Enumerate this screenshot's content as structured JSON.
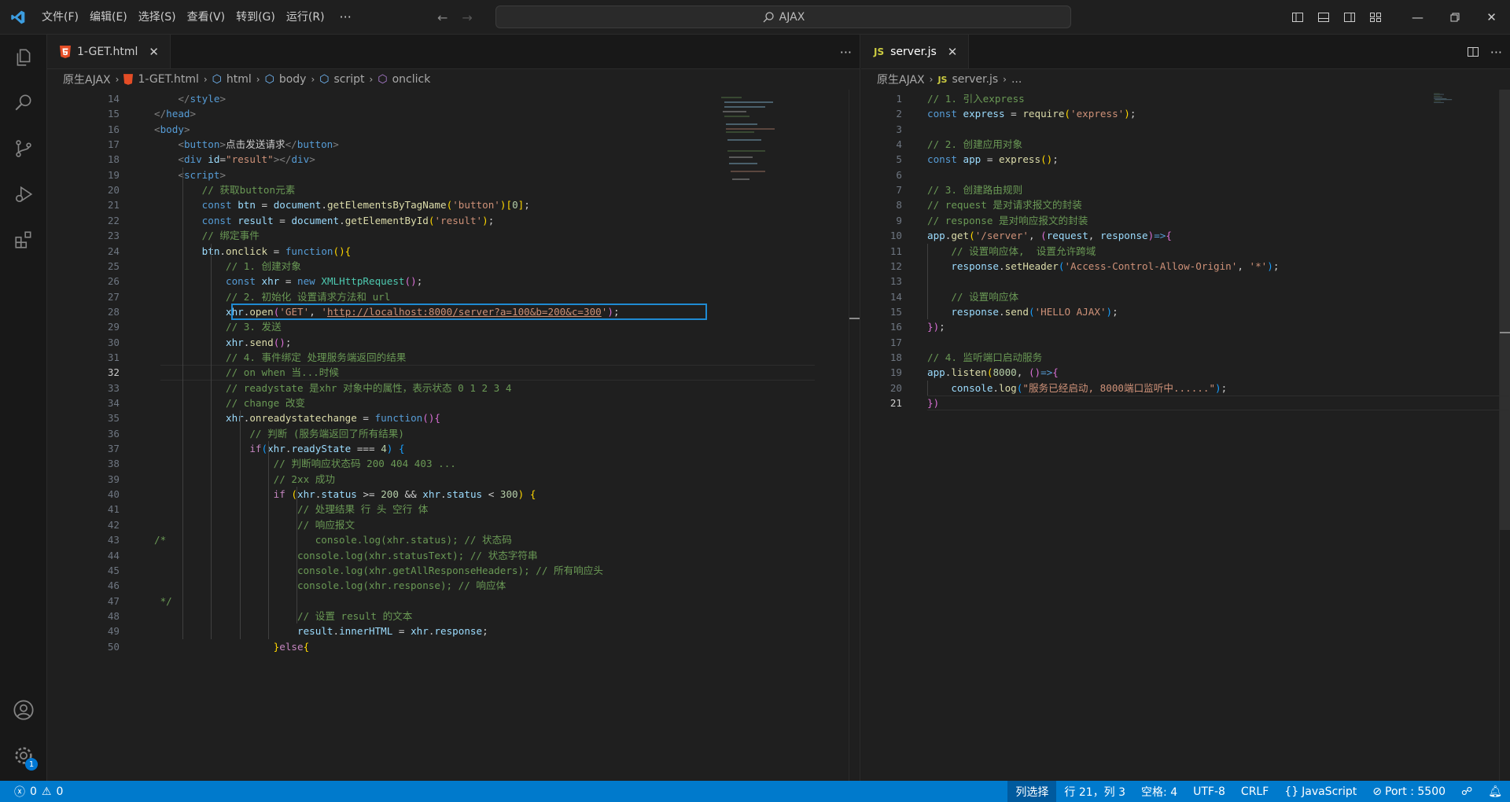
{
  "menu": [
    "文件(F)",
    "编辑(E)",
    "选择(S)",
    "查看(V)",
    "转到(G)",
    "运行(R)"
  ],
  "search": {
    "label": "AJAX"
  },
  "left": {
    "tab": "1-GET.html",
    "breadcrumb": [
      "原生AJAX",
      "1-GET.html",
      "html",
      "body",
      "script",
      "onclick"
    ],
    "current_line": "32"
  },
  "right": {
    "tab": "server.js",
    "breadcrumb": [
      "原生AJAX",
      "server.js",
      "..."
    ],
    "current_line": "21"
  },
  "status": {
    "errors": "0",
    "warnings": "0",
    "selection_mode": "列选择",
    "position": "行 21，列 3",
    "spaces": "空格: 4",
    "encoding": "UTF-8",
    "eol": "CRLF",
    "language": "JavaScript",
    "port": "Port : 5500"
  },
  "activity_badge": "1",
  "colors": {
    "accent": "#007acc",
    "highlight_box": "#1f8ad2"
  },
  "left_code": [
    {
      "n": "14",
      "t": [
        [
          "    ",
          "c-plain"
        ],
        [
          "</",
          "c-tagb"
        ],
        [
          "style",
          "c-tag"
        ],
        [
          ">",
          "c-tagb"
        ]
      ]
    },
    {
      "n": "15",
      "t": [
        [
          "</",
          "c-tagb"
        ],
        [
          "head",
          "c-tag"
        ],
        [
          ">",
          "c-tagb"
        ]
      ]
    },
    {
      "n": "16",
      "t": [
        [
          "<",
          "c-tagb"
        ],
        [
          "body",
          "c-tag"
        ],
        [
          ">",
          "c-tagb"
        ]
      ]
    },
    {
      "n": "17",
      "t": [
        [
          "    ",
          "c-plain"
        ],
        [
          "<",
          "c-tagb"
        ],
        [
          "button",
          "c-tag"
        ],
        [
          ">",
          "c-tagb"
        ],
        [
          "点击发送请求",
          "c-plain"
        ],
        [
          "</",
          "c-tagb"
        ],
        [
          "button",
          "c-tag"
        ],
        [
          ">",
          "c-tagb"
        ]
      ]
    },
    {
      "n": "18",
      "t": [
        [
          "    ",
          "c-plain"
        ],
        [
          "<",
          "c-tagb"
        ],
        [
          "div",
          "c-tag"
        ],
        [
          " ",
          "c-plain"
        ],
        [
          "id",
          "c-attr"
        ],
        [
          "=",
          "c-plain"
        ],
        [
          "\"result\"",
          "c-str"
        ],
        [
          "></",
          "c-tagb"
        ],
        [
          "div",
          "c-tag"
        ],
        [
          ">",
          "c-tagb"
        ]
      ]
    },
    {
      "n": "19",
      "t": [
        [
          "    ",
          "c-plain"
        ],
        [
          "<",
          "c-tagb"
        ],
        [
          "script",
          "c-tag"
        ],
        [
          ">",
          "c-tagb"
        ]
      ]
    },
    {
      "n": "20",
      "t": [
        [
          "        ",
          "c-plain"
        ],
        [
          "// 获取button元素",
          "c-com"
        ]
      ]
    },
    {
      "n": "21",
      "t": [
        [
          "        ",
          "c-plain"
        ],
        [
          "const",
          "c-kw"
        ],
        [
          " ",
          "c-plain"
        ],
        [
          "btn",
          "c-var"
        ],
        [
          " = ",
          "c-plain"
        ],
        [
          "document",
          "c-var"
        ],
        [
          ".",
          "c-plain"
        ],
        [
          "getElementsByTagName",
          "c-fn"
        ],
        [
          "(",
          "c-b1"
        ],
        [
          "'button'",
          "c-str"
        ],
        [
          ")",
          "c-b1"
        ],
        [
          "[",
          "c-b1"
        ],
        [
          "0",
          "c-num"
        ],
        [
          "]",
          "c-b1"
        ],
        [
          ";",
          "c-plain"
        ]
      ]
    },
    {
      "n": "22",
      "t": [
        [
          "        ",
          "c-plain"
        ],
        [
          "const",
          "c-kw"
        ],
        [
          " ",
          "c-plain"
        ],
        [
          "result",
          "c-var"
        ],
        [
          " = ",
          "c-plain"
        ],
        [
          "document",
          "c-var"
        ],
        [
          ".",
          "c-plain"
        ],
        [
          "getElementById",
          "c-fn"
        ],
        [
          "(",
          "c-b1"
        ],
        [
          "'result'",
          "c-str"
        ],
        [
          ")",
          "c-b1"
        ],
        [
          ";",
          "c-plain"
        ]
      ]
    },
    {
      "n": "23",
      "t": [
        [
          "        ",
          "c-plain"
        ],
        [
          "// 绑定事件",
          "c-com"
        ]
      ]
    },
    {
      "n": "24",
      "t": [
        [
          "        ",
          "c-plain"
        ],
        [
          "btn",
          "c-var"
        ],
        [
          ".",
          "c-plain"
        ],
        [
          "onclick",
          "c-fn"
        ],
        [
          " = ",
          "c-plain"
        ],
        [
          "function",
          "c-kw"
        ],
        [
          "(){",
          "c-b1"
        ]
      ]
    },
    {
      "n": "25",
      "t": [
        [
          "            ",
          "c-plain"
        ],
        [
          "// 1. 创建对象",
          "c-com"
        ]
      ]
    },
    {
      "n": "26",
      "t": [
        [
          "            ",
          "c-plain"
        ],
        [
          "const",
          "c-kw"
        ],
        [
          " ",
          "c-plain"
        ],
        [
          "xhr",
          "c-var"
        ],
        [
          " = ",
          "c-plain"
        ],
        [
          "new",
          "c-kw"
        ],
        [
          " ",
          "c-plain"
        ],
        [
          "XMLHttpRequest",
          "c-cls"
        ],
        [
          "()",
          "c-b2"
        ],
        [
          ";",
          "c-plain"
        ]
      ]
    },
    {
      "n": "27",
      "t": [
        [
          "            ",
          "c-plain"
        ],
        [
          "// 2. 初始化 设置请求方法和 url",
          "c-com"
        ]
      ]
    },
    {
      "n": "28",
      "t": [
        [
          "            ",
          "c-plain"
        ],
        [
          "xhr",
          "c-var"
        ],
        [
          ".",
          "c-plain"
        ],
        [
          "open",
          "c-fn"
        ],
        [
          "(",
          "c-b2"
        ],
        [
          "'GET'",
          "c-str"
        ],
        [
          ", ",
          "c-plain"
        ],
        [
          "'",
          "c-str"
        ],
        [
          "http://localhost:8000/server?a=100&b=200&c=300",
          "c-str c-under"
        ],
        [
          "'",
          "c-str"
        ],
        [
          ")",
          "c-b2"
        ],
        [
          ";",
          "c-plain"
        ]
      ]
    },
    {
      "n": "29",
      "t": [
        [
          "            ",
          "c-plain"
        ],
        [
          "// 3. 发送",
          "c-com"
        ]
      ]
    },
    {
      "n": "30",
      "t": [
        [
          "            ",
          "c-plain"
        ],
        [
          "xhr",
          "c-var"
        ],
        [
          ".",
          "c-plain"
        ],
        [
          "send",
          "c-fn"
        ],
        [
          "()",
          "c-b2"
        ],
        [
          ";",
          "c-plain"
        ]
      ]
    },
    {
      "n": "31",
      "t": [
        [
          "            ",
          "c-plain"
        ],
        [
          "// 4. 事件绑定 处理服务端返回的结果",
          "c-com"
        ]
      ]
    },
    {
      "n": "32",
      "t": [
        [
          "            ",
          "c-plain"
        ],
        [
          "// on when 当...时候",
          "c-com"
        ]
      ]
    },
    {
      "n": "33",
      "t": [
        [
          "            ",
          "c-plain"
        ],
        [
          "// readystate 是xhr 对象中的属性，表示状态 0 1 2 3 4",
          "c-com"
        ]
      ]
    },
    {
      "n": "34",
      "t": [
        [
          "            ",
          "c-plain"
        ],
        [
          "// change 改变",
          "c-com"
        ]
      ]
    },
    {
      "n": "35",
      "t": [
        [
          "            ",
          "c-plain"
        ],
        [
          "xhr",
          "c-var"
        ],
        [
          ".",
          "c-plain"
        ],
        [
          "onreadystatechange",
          "c-fn"
        ],
        [
          " = ",
          "c-plain"
        ],
        [
          "function",
          "c-kw"
        ],
        [
          "(){",
          "c-b2"
        ]
      ]
    },
    {
      "n": "36",
      "t": [
        [
          "                ",
          "c-plain"
        ],
        [
          "// 判断 (服务端返回了所有结果)",
          "c-com"
        ]
      ]
    },
    {
      "n": "37",
      "t": [
        [
          "                ",
          "c-plain"
        ],
        [
          "if",
          "c-ctrl"
        ],
        [
          "(",
          "c-b3"
        ],
        [
          "xhr",
          "c-var"
        ],
        [
          ".",
          "c-plain"
        ],
        [
          "readyState",
          "c-var"
        ],
        [
          " === ",
          "c-plain"
        ],
        [
          "4",
          "c-num"
        ],
        [
          ")",
          "c-b3"
        ],
        [
          " ",
          "c-plain"
        ],
        [
          "{",
          "c-b3"
        ]
      ]
    },
    {
      "n": "38",
      "t": [
        [
          "                    ",
          "c-plain"
        ],
        [
          "// 判断响应状态码 200 404 403 ...",
          "c-com"
        ]
      ]
    },
    {
      "n": "39",
      "t": [
        [
          "                    ",
          "c-plain"
        ],
        [
          "// 2xx 成功",
          "c-com"
        ]
      ]
    },
    {
      "n": "40",
      "t": [
        [
          "                    ",
          "c-plain"
        ],
        [
          "if",
          "c-ctrl"
        ],
        [
          " ",
          "c-plain"
        ],
        [
          "(",
          "c-b1"
        ],
        [
          "xhr",
          "c-var"
        ],
        [
          ".",
          "c-plain"
        ],
        [
          "status",
          "c-var"
        ],
        [
          " >= ",
          "c-plain"
        ],
        [
          "200",
          "c-num"
        ],
        [
          " && ",
          "c-plain"
        ],
        [
          "xhr",
          "c-var"
        ],
        [
          ".",
          "c-plain"
        ],
        [
          "status",
          "c-var"
        ],
        [
          " < ",
          "c-plain"
        ],
        [
          "300",
          "c-num"
        ],
        [
          ")",
          "c-b1"
        ],
        [
          " ",
          "c-plain"
        ],
        [
          "{",
          "c-b1"
        ]
      ]
    },
    {
      "n": "41",
      "t": [
        [
          "                        ",
          "c-plain"
        ],
        [
          "// 处理结果 行 头 空行 体",
          "c-com"
        ]
      ]
    },
    {
      "n": "42",
      "t": [
        [
          "                        ",
          "c-plain"
        ],
        [
          "// 响应报文",
          "c-com"
        ]
      ]
    },
    {
      "n": "43",
      "t": [
        [
          "/*                         console.log(xhr.status); // 状态码",
          "c-com"
        ]
      ]
    },
    {
      "n": "44",
      "t": [
        [
          "                        console.log(xhr.statusText); // 状态字符串",
          "c-com"
        ]
      ]
    },
    {
      "n": "45",
      "t": [
        [
          "                        console.log(xhr.getAllResponseHeaders); // 所有响应头",
          "c-com"
        ]
      ]
    },
    {
      "n": "46",
      "t": [
        [
          "                        console.log(xhr.response); // 响应体",
          "c-com"
        ]
      ]
    },
    {
      "n": "47",
      "t": [
        [
          " */",
          "c-com"
        ]
      ]
    },
    {
      "n": "48",
      "t": [
        [
          "                        ",
          "c-plain"
        ],
        [
          "// 设置 result 的文本",
          "c-com"
        ]
      ]
    },
    {
      "n": "49",
      "t": [
        [
          "                        ",
          "c-plain"
        ],
        [
          "result",
          "c-var"
        ],
        [
          ".",
          "c-plain"
        ],
        [
          "innerHTML",
          "c-var"
        ],
        [
          " = ",
          "c-plain"
        ],
        [
          "xhr",
          "c-var"
        ],
        [
          ".",
          "c-plain"
        ],
        [
          "response",
          "c-var"
        ],
        [
          ";",
          "c-plain"
        ]
      ]
    },
    {
      "n": "50",
      "t": [
        [
          "                    ",
          "c-plain"
        ],
        [
          "}",
          "c-b1"
        ],
        [
          "else",
          "c-ctrl"
        ],
        [
          "{",
          "c-b1"
        ]
      ]
    }
  ],
  "right_code": [
    {
      "n": "1",
      "t": [
        [
          "// 1. 引入express",
          "c-com"
        ]
      ]
    },
    {
      "n": "2",
      "t": [
        [
          "const",
          "c-kw"
        ],
        [
          " ",
          "c-plain"
        ],
        [
          "express",
          "c-var"
        ],
        [
          " = ",
          "c-plain"
        ],
        [
          "require",
          "c-fn"
        ],
        [
          "(",
          "c-b1"
        ],
        [
          "'express'",
          "c-str"
        ],
        [
          ")",
          "c-b1"
        ],
        [
          ";",
          "c-plain"
        ]
      ]
    },
    {
      "n": "3",
      "t": []
    },
    {
      "n": "4",
      "t": [
        [
          "// 2. 创建应用对象",
          "c-com"
        ]
      ]
    },
    {
      "n": "5",
      "t": [
        [
          "const",
          "c-kw"
        ],
        [
          " ",
          "c-plain"
        ],
        [
          "app",
          "c-var"
        ],
        [
          " = ",
          "c-plain"
        ],
        [
          "express",
          "c-fn"
        ],
        [
          "()",
          "c-b1"
        ],
        [
          ";",
          "c-plain"
        ]
      ]
    },
    {
      "n": "6",
      "t": []
    },
    {
      "n": "7",
      "t": [
        [
          "// 3. 创建路由规则",
          "c-com"
        ]
      ]
    },
    {
      "n": "8",
      "t": [
        [
          "// request 是对请求报文的封装",
          "c-com"
        ]
      ]
    },
    {
      "n": "9",
      "t": [
        [
          "// response 是对响应报文的封装",
          "c-com"
        ]
      ]
    },
    {
      "n": "10",
      "t": [
        [
          "app",
          "c-var"
        ],
        [
          ".",
          "c-plain"
        ],
        [
          "get",
          "c-fn"
        ],
        [
          "(",
          "c-b1"
        ],
        [
          "'/server'",
          "c-str"
        ],
        [
          ", ",
          "c-plain"
        ],
        [
          "(",
          "c-b2"
        ],
        [
          "request",
          "c-var"
        ],
        [
          ", ",
          "c-plain"
        ],
        [
          "response",
          "c-var"
        ],
        [
          ")",
          "c-b2"
        ],
        [
          "=>",
          "c-kw"
        ],
        [
          "{",
          "c-b2"
        ]
      ]
    },
    {
      "n": "11",
      "t": [
        [
          "    ",
          "c-plain"
        ],
        [
          "// 设置响应体,  设置允许跨域",
          "c-com"
        ]
      ]
    },
    {
      "n": "12",
      "t": [
        [
          "    ",
          "c-plain"
        ],
        [
          "response",
          "c-var"
        ],
        [
          ".",
          "c-plain"
        ],
        [
          "setHeader",
          "c-fn"
        ],
        [
          "(",
          "c-b3"
        ],
        [
          "'Access-Control-Allow-Origin'",
          "c-str"
        ],
        [
          ", ",
          "c-plain"
        ],
        [
          "'*'",
          "c-str"
        ],
        [
          ")",
          "c-b3"
        ],
        [
          ";",
          "c-plain"
        ]
      ]
    },
    {
      "n": "13",
      "t": []
    },
    {
      "n": "14",
      "t": [
        [
          "    ",
          "c-plain"
        ],
        [
          "// 设置响应体",
          "c-com"
        ]
      ]
    },
    {
      "n": "15",
      "t": [
        [
          "    ",
          "c-plain"
        ],
        [
          "response",
          "c-var"
        ],
        [
          ".",
          "c-plain"
        ],
        [
          "send",
          "c-fn"
        ],
        [
          "(",
          "c-b3"
        ],
        [
          "'HELLO AJAX'",
          "c-str"
        ],
        [
          ")",
          "c-b3"
        ],
        [
          ";",
          "c-plain"
        ]
      ]
    },
    {
      "n": "16",
      "t": [
        [
          "})",
          "c-b2"
        ],
        [
          ";",
          "c-plain"
        ]
      ]
    },
    {
      "n": "17",
      "t": []
    },
    {
      "n": "18",
      "t": [
        [
          "// 4. 监听端口启动服务",
          "c-com"
        ]
      ]
    },
    {
      "n": "19",
      "t": [
        [
          "app",
          "c-var"
        ],
        [
          ".",
          "c-plain"
        ],
        [
          "listen",
          "c-fn"
        ],
        [
          "(",
          "c-b1"
        ],
        [
          "8000",
          "c-num"
        ],
        [
          ", ",
          "c-plain"
        ],
        [
          "()",
          "c-b2"
        ],
        [
          "=>",
          "c-kw"
        ],
        [
          "{",
          "c-b2"
        ]
      ]
    },
    {
      "n": "20",
      "t": [
        [
          "    ",
          "c-plain"
        ],
        [
          "console",
          "c-var"
        ],
        [
          ".",
          "c-plain"
        ],
        [
          "log",
          "c-fn"
        ],
        [
          "(",
          "c-b3"
        ],
        [
          "\"服务已经启动, 8000端口监听中......\"",
          "c-str"
        ],
        [
          ")",
          "c-b3"
        ],
        [
          ";",
          "c-plain"
        ]
      ]
    },
    {
      "n": "21",
      "t": [
        [
          "})",
          "c-b2"
        ]
      ]
    }
  ]
}
